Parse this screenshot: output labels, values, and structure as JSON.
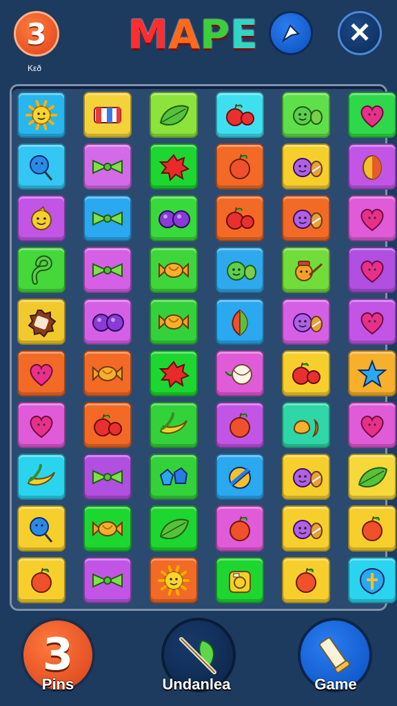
{
  "header": {
    "level_number": "3",
    "level_caption": "Kεð",
    "title_letters": [
      {
        "char": "M",
        "color": "#ff2d2d"
      },
      {
        "char": "A",
        "color": "#ff6a1a"
      },
      {
        "char": "P",
        "color": "#39d13a"
      },
      {
        "char": "E",
        "color": "#2fd6c4"
      }
    ],
    "share_icon": "share-arrow-icon",
    "close_label": "✕"
  },
  "board": {
    "rows": [
      [
        {
          "bg": "#27b7ee",
          "icon": "sun"
        },
        {
          "bg": "#f4d23a",
          "icon": "candy-stripe"
        },
        {
          "bg": "#8be33b",
          "icon": "leaf"
        },
        {
          "bg": "#3ee0f0",
          "icon": "apple-pair"
        },
        {
          "bg": "#5fe04a",
          "icon": "face-leaf"
        },
        {
          "bg": "#2fd84a",
          "icon": "heart"
        }
      ],
      [
        {
          "bg": "#34c6f4",
          "icon": "lollipop"
        },
        {
          "bg": "#d36be8",
          "icon": "bow"
        },
        {
          "bg": "#1ed630",
          "icon": "splat"
        },
        {
          "bg": "#f26a25",
          "icon": "apple"
        },
        {
          "bg": "#f6cf2c",
          "icon": "face-pair"
        },
        {
          "bg": "#c255e6",
          "icon": "egg"
        }
      ],
      [
        {
          "bg": "#c255e6",
          "icon": "face"
        },
        {
          "bg": "#2aa8f0",
          "icon": "bow"
        },
        {
          "bg": "#38d93a",
          "icon": "grape-pair"
        },
        {
          "bg": "#f26a25",
          "icon": "apple-pair"
        },
        {
          "bg": "#f26a25",
          "icon": "face-pair"
        },
        {
          "bg": "#e05bd8",
          "icon": "heart"
        }
      ],
      [
        {
          "bg": "#44d83a",
          "icon": "hook"
        },
        {
          "bg": "#d560e6",
          "icon": "bow"
        },
        {
          "bg": "#3ed63a",
          "icon": "wrapped-candy"
        },
        {
          "bg": "#2fa9ee",
          "icon": "face-leaf"
        },
        {
          "bg": "#72dc3a",
          "icon": "face-pin"
        },
        {
          "bg": "#b04fe0",
          "icon": "heart"
        }
      ],
      [
        {
          "bg": "#f2c92c",
          "icon": "cookie"
        },
        {
          "bg": "#d560e6",
          "icon": "grape-pair"
        },
        {
          "bg": "#34d23a",
          "icon": "wrapped-candy"
        },
        {
          "bg": "#2aa8f0",
          "icon": "leaf-drop"
        },
        {
          "bg": "#d560e6",
          "icon": "face-pair"
        },
        {
          "bg": "#c255e6",
          "icon": "heart"
        }
      ],
      [
        {
          "bg": "#f26a25",
          "icon": "heart"
        },
        {
          "bg": "#f26a25",
          "icon": "wrapped-candy"
        },
        {
          "bg": "#1ed630",
          "icon": "splat"
        },
        {
          "bg": "#e05bd8",
          "icon": "candy-ball"
        },
        {
          "bg": "#f6cf2c",
          "icon": "apple-pair"
        },
        {
          "bg": "#f6b02c",
          "icon": "star"
        }
      ],
      [
        {
          "bg": "#e05bd8",
          "icon": "heart"
        },
        {
          "bg": "#f26a25",
          "icon": "apple-pair"
        },
        {
          "bg": "#34d23a",
          "icon": "banana"
        },
        {
          "bg": "#c255e6",
          "icon": "apple"
        },
        {
          "bg": "#2ed6a8",
          "icon": "blob-pair"
        },
        {
          "bg": "#e05bd8",
          "icon": "heart"
        }
      ],
      [
        {
          "bg": "#2ad4ee",
          "icon": "banana"
        },
        {
          "bg": "#b04fe0",
          "icon": "bow"
        },
        {
          "bg": "#34d23a",
          "icon": "gem-pair"
        },
        {
          "bg": "#2aa8f0",
          "icon": "ball-stripe"
        },
        {
          "bg": "#f6cf2c",
          "icon": "face-pair"
        },
        {
          "bg": "#f6d83a",
          "icon": "leaf"
        }
      ],
      [
        {
          "bg": "#f6cf2c",
          "icon": "lollipop"
        },
        {
          "bg": "#1ed630",
          "icon": "wrapped-candy"
        },
        {
          "bg": "#1ed630",
          "icon": "leaf"
        },
        {
          "bg": "#e05bd8",
          "icon": "apple"
        },
        {
          "bg": "#f6cf2c",
          "icon": "face-pair"
        },
        {
          "bg": "#f6cf2c",
          "icon": "apple"
        }
      ],
      [
        {
          "bg": "#f6cf2c",
          "icon": "apple"
        },
        {
          "bg": "#c255e6",
          "icon": "bow"
        },
        {
          "bg": "#f26a25",
          "icon": "sun"
        },
        {
          "bg": "#1ed630",
          "icon": "camera-face"
        },
        {
          "bg": "#f6cf2c",
          "icon": "apple"
        },
        {
          "bg": "#2ad4ee",
          "icon": "shield-cross"
        }
      ]
    ]
  },
  "footer": {
    "pins_number": "3",
    "pins_label": "Pins",
    "undo_label": "Undanlea",
    "undo_icon": "leaf-arrow-icon",
    "game_label": "Game",
    "game_icon": "scroll-icon"
  }
}
